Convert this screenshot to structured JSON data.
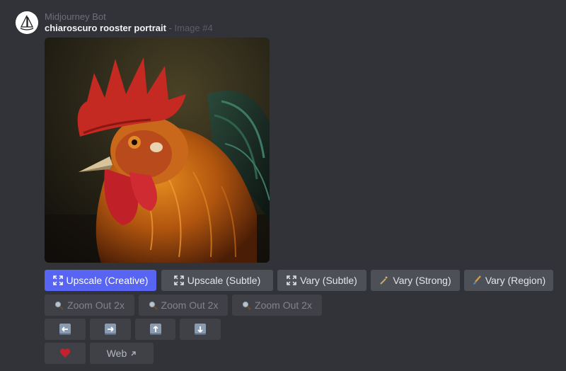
{
  "message": {
    "author": "Midjourney Bot",
    "prompt": "chiaroscuro rooster portrait",
    "separator": " - ",
    "image_label": "Image #4"
  },
  "image": {
    "icon": "rooster-portrait-image"
  },
  "buttons": {
    "row1": [
      {
        "label": "Upscale (Creative)",
        "icon": "expand-icon",
        "style": "primary"
      },
      {
        "label": "Upscale (Subtle)",
        "icon": "expand-icon",
        "style": "secondary"
      },
      {
        "label": "Vary (Subtle)",
        "icon": "expand-icon",
        "style": "secondary"
      },
      {
        "label": "Vary (Strong)",
        "icon": "magic-wand-icon",
        "style": "secondary"
      },
      {
        "label": "Vary (Region)",
        "icon": "paintbrush-icon",
        "style": "secondary"
      }
    ],
    "row2": [
      {
        "label": "Zoom Out 2x",
        "icon": "magnifier-icon",
        "style": "disabled"
      },
      {
        "label": "Zoom Out 2x",
        "icon": "magnifier-icon",
        "style": "disabled"
      },
      {
        "label": "Zoom Out 2x",
        "icon": "magnifier-icon",
        "style": "disabled"
      }
    ],
    "row3": [
      {
        "icon": "arrow-left-icon",
        "style": "disabled"
      },
      {
        "icon": "arrow-right-icon",
        "style": "disabled"
      },
      {
        "icon": "arrow-up-icon",
        "style": "disabled"
      },
      {
        "icon": "arrow-down-icon",
        "style": "disabled"
      }
    ],
    "row4": [
      {
        "icon": "heart-icon",
        "style": "disabled"
      },
      {
        "label": "Web",
        "icon": "external-link-icon",
        "style": "disabled"
      }
    ]
  },
  "colors": {
    "background": "#313338",
    "primary": "#5865f2",
    "secondary": "#4e5058",
    "disabled": "#3f4147",
    "heart": "#c4212c"
  }
}
